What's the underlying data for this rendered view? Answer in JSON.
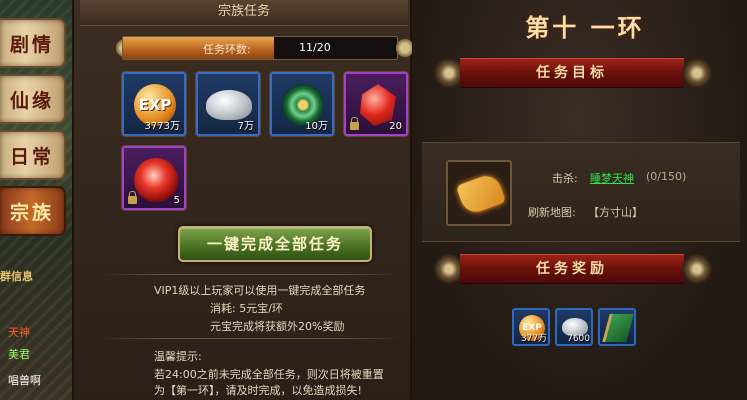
{
  "sidebar": {
    "tabs": [
      {
        "label": "剧情",
        "active": false
      },
      {
        "label": "仙缘",
        "active": false
      },
      {
        "label": "日常",
        "active": false
      },
      {
        "label": "宗族",
        "active": true
      }
    ],
    "bottom_texts": [
      "群信息",
      "天神",
      "美君",
      "唱兽啊"
    ]
  },
  "clan_task": {
    "header": "宗族任务",
    "progress_label": "任务环数:",
    "progress_value": "11/20",
    "progress_fraction": 0.55,
    "items": [
      {
        "icon": "exp-icon",
        "label": "EXP",
        "qty": "3773万",
        "rarity": "blue",
        "locked": false
      },
      {
        "icon": "silver-ingot-icon",
        "qty": "7万",
        "rarity": "blue",
        "locked": false
      },
      {
        "icon": "jade-orb-icon",
        "qty": "10万",
        "rarity": "blue",
        "locked": false
      },
      {
        "icon": "red-crystal-icon",
        "qty": "20",
        "rarity": "purple",
        "locked": true
      },
      {
        "icon": "red-orb-icon",
        "qty": "5",
        "rarity": "purple",
        "locked": true
      }
    ],
    "complete_button": "一键完成全部任务",
    "vip_note": "VIP1级以上玩家可以使用一键完成全部任务",
    "cost_note": "消耗: 5元宝/环",
    "bonus_note": "元宝完成将获额外20%奖励",
    "tip_title": "温馨提示:",
    "tip_line1": "若24:00之前未完成全部任务，则次日将被重置",
    "tip_line2": "为【第一环】，请及时完成，以免造成损失!"
  },
  "ring": {
    "title": "第十 一环",
    "objective_header": "任务目标",
    "kill_label": "击杀:",
    "kill_target": "睡梦天神",
    "kill_count": "(0/150)",
    "refresh_label": "刷新地图:",
    "refresh_map": "【方寸山】",
    "reward_header": "任务奖励",
    "rewards": [
      {
        "icon": "exp-icon",
        "label": "EXP",
        "qty": "377万"
      },
      {
        "icon": "silver-ingot-icon",
        "qty": "7600"
      },
      {
        "icon": "flag-icon",
        "qty": ""
      }
    ]
  },
  "colors": {
    "accent_green": "#2fe04a",
    "banner_red": "#6a0f0a",
    "progress_orange": "#e9a54c"
  }
}
